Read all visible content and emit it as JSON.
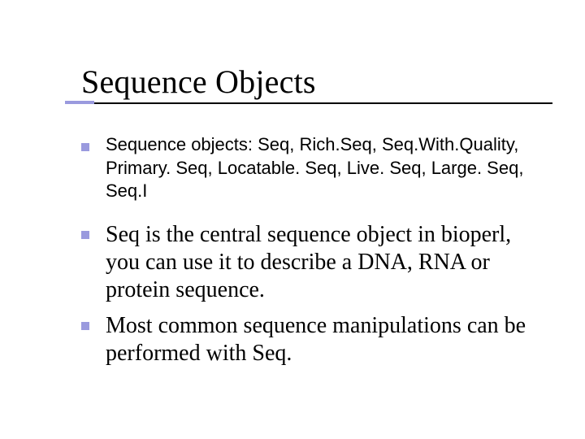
{
  "slide": {
    "title": "Sequence Objects",
    "bullets": [
      {
        "text": "Sequence objects: Seq, Rich.Seq, Seq.With.Quality, Primary. Seq,  Locatable. Seq,  Live. Seq,  Large. Seq, Seq.I",
        "size": "sm"
      },
      {
        "text": "Seq is the central sequence object in bioperl, you can use it to describe a DNA, RNA or protein sequence.",
        "size": "lg"
      },
      {
        "text": "Most common sequence manipulations can be performed with Seq.",
        "size": "lg"
      }
    ]
  }
}
